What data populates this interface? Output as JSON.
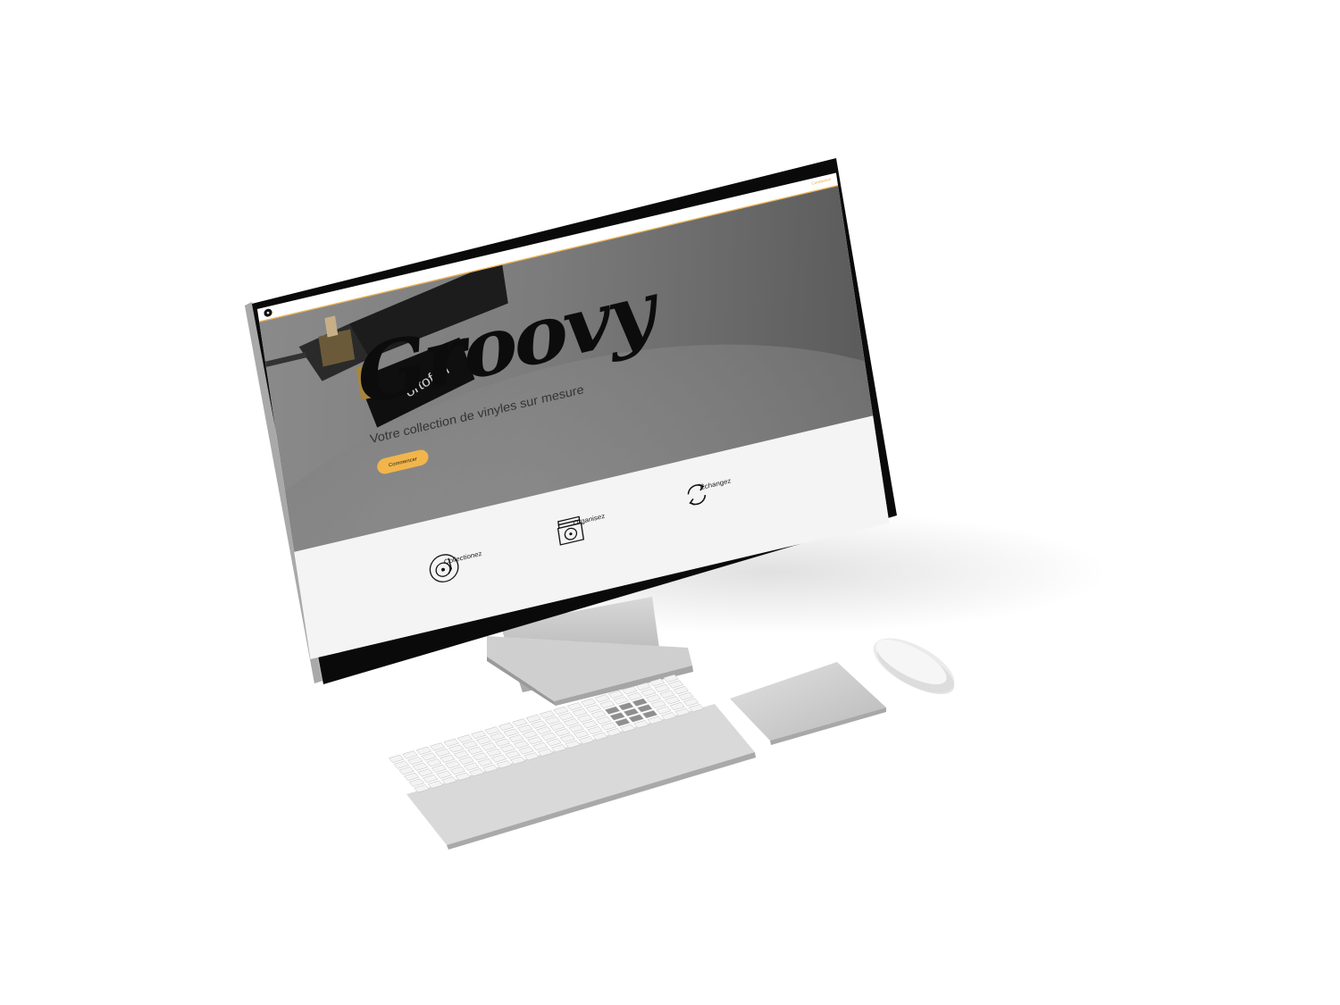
{
  "nav": {
    "login_label": "Connexion"
  },
  "hero": {
    "title": "Groovy",
    "subtitle": "Votre collection de vinyles sur mesure",
    "cta_label": "Commencer",
    "cartridge_brand": "ortofon"
  },
  "features": [
    {
      "label": "Collectionez",
      "icon": "turntable-icon"
    },
    {
      "label": "Organisez",
      "icon": "record-stack-icon"
    },
    {
      "label": "Échangez",
      "icon": "refresh-icon"
    }
  ],
  "colors": {
    "accent": "#f2b54b",
    "title": "#0c0c0c",
    "hero_gray": "#7c7c7c",
    "bezel": "#0a0a0a",
    "aluminium": "#c9c9c9"
  }
}
